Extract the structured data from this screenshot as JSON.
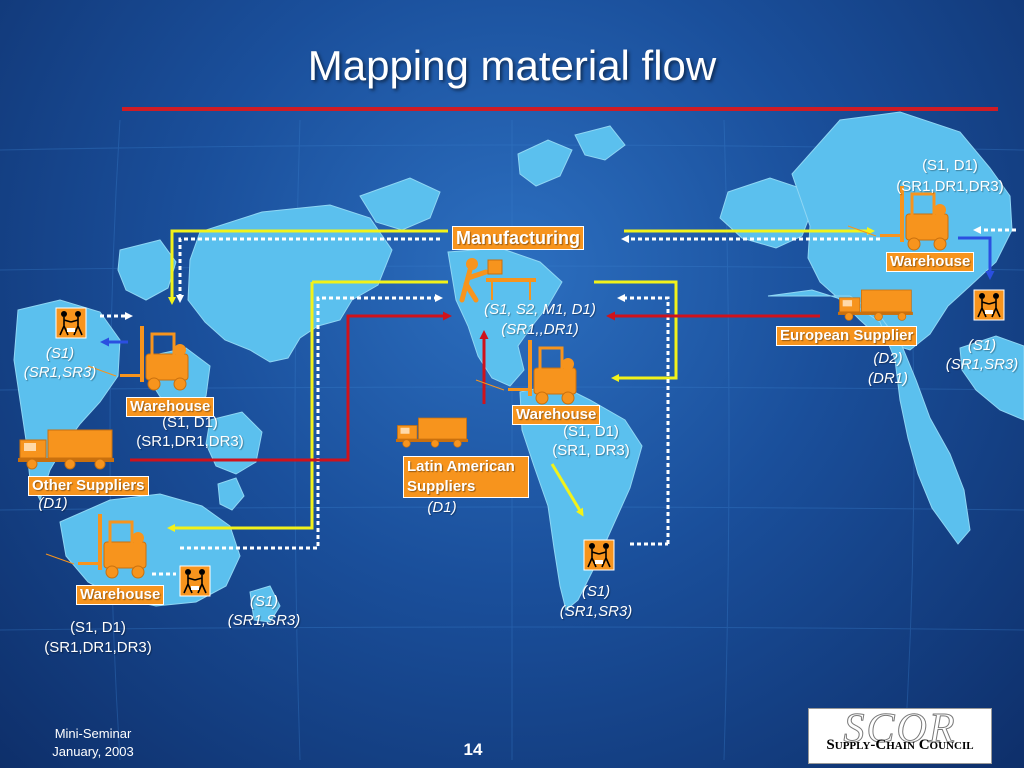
{
  "title": "Mapping material flow",
  "labels": {
    "manufacturing": "Manufacturing",
    "warehouse": "Warehouse",
    "european_supplier": "European Supplier",
    "other_suppliers": "Other Suppliers",
    "latin_american_suppliers": "Latin American Suppliers"
  },
  "codes": {
    "east_warehouse": [
      "(S1, D1)",
      "(SR1,DR1,DR3)"
    ],
    "manufacturing": [
      "(S1, S2, M1, D1)",
      "(SR1,,DR1)"
    ],
    "west_customer": [
      "(S1)",
      "(SR1,SR3)"
    ],
    "west_warehouse": [
      "(S1, D1)",
      "(SR1,DR1,DR3)"
    ],
    "central_warehouse": [
      "(S1, D1)",
      "(SR1, DR3)"
    ],
    "european_supplier": [
      "(D2)",
      "(DR1)"
    ],
    "east_customer": [
      "(S1)",
      "(SR1,SR3)"
    ],
    "other_suppliers": [
      "(D1)"
    ],
    "latin_american": [
      "(D1)"
    ],
    "south_customer": [
      "(S1)",
      "(SR1,SR3)"
    ],
    "southwest_customer": [
      "(S1)",
      "(SR1,SR3)"
    ],
    "southwest_warehouse": [
      "(S1, D1)",
      "(SR1,DR1,DR3)"
    ]
  },
  "footer": {
    "event": "Mini-Seminar",
    "date": "January, 2003",
    "page_number": "14"
  },
  "logo": {
    "mark": "SCOR",
    "text": "Supply-Chain Council"
  },
  "colors": {
    "background": "#1a4f9b",
    "land": "#5bc0ee",
    "label_fill": "#f7941d",
    "flow_yellow": "#f2f21a",
    "flow_red": "#d0121b",
    "flow_blue": "#2b4fe0",
    "title_rule": "#d01c24"
  }
}
